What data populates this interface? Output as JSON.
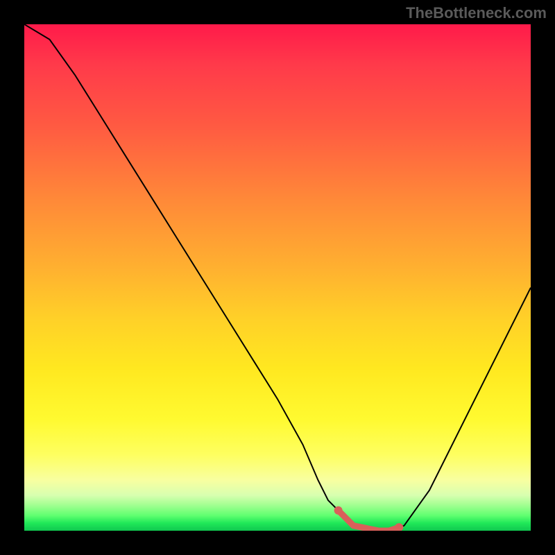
{
  "watermark": "TheBottleneck.com",
  "colors": {
    "background": "#000000",
    "curve": "#000000",
    "marker": "#d9605a",
    "watermark_text": "#5a5a5a"
  },
  "chart_data": {
    "type": "line",
    "title": "",
    "xlabel": "",
    "ylabel": "",
    "xlim": [
      0,
      100
    ],
    "ylim": [
      0,
      100
    ],
    "x": [
      0,
      5,
      10,
      15,
      20,
      25,
      30,
      35,
      40,
      45,
      50,
      55,
      58,
      60,
      65,
      70,
      72,
      75,
      80,
      85,
      90,
      95,
      100
    ],
    "values": [
      100,
      97,
      90,
      82,
      74,
      66,
      58,
      50,
      42,
      34,
      26,
      17,
      10,
      6,
      1,
      0,
      0,
      1,
      8,
      18,
      28,
      38,
      48
    ],
    "optimal_range_x": [
      62,
      74
    ],
    "gradient_stops": [
      {
        "pos": 0.0,
        "color": "#ff1a4a"
      },
      {
        "pos": 0.3,
        "color": "#ff7a3a"
      },
      {
        "pos": 0.6,
        "color": "#ffda28"
      },
      {
        "pos": 0.85,
        "color": "#feff60"
      },
      {
        "pos": 0.97,
        "color": "#60ff70"
      },
      {
        "pos": 1.0,
        "color": "#10c850"
      }
    ],
    "annotations": []
  }
}
